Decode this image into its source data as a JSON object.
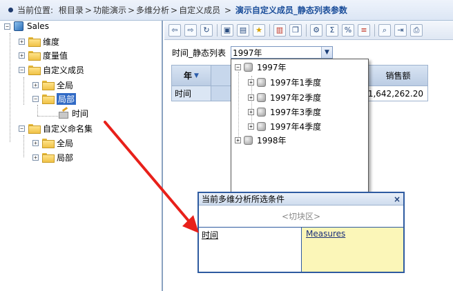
{
  "breadcrumb": {
    "prefix": "当前位置:",
    "parts": [
      "根目录",
      "功能演示",
      "多维分析",
      "自定义成员"
    ],
    "current": "演示自定义成员_静态列表参数"
  },
  "tree": {
    "root": "Sales",
    "items": [
      "维度",
      "度量值",
      "自定义成员",
      "全局",
      "局部",
      "时间",
      "自定义命名集",
      "全局",
      "局部"
    ]
  },
  "toolbar": {
    "icons": [
      "back-icon",
      "forward-icon",
      "refresh-icon",
      "save-icon",
      "save-as-icon",
      "favorite-icon",
      "chart-icon",
      "copy-icon",
      "settings-icon",
      "sum-icon",
      "format-icon",
      "filter-icon",
      "zoom-icon",
      "export-icon",
      "print-icon"
    ]
  },
  "param": {
    "label": "时间_静态列表",
    "value": "1997年"
  },
  "grid": {
    "row_header": "年",
    "measure_header": "销售额",
    "row_label": "时间",
    "value": "41,642,262.20"
  },
  "dropdown": {
    "items": [
      "1997年",
      "1997年1季度",
      "1997年2季度",
      "1997年3季度",
      "1997年4季度",
      "1998年"
    ]
  },
  "slicer": {
    "title": "当前多维分析所选条件",
    "close": "×",
    "zone": "<切块区>",
    "left": "时间",
    "right": "Measures"
  },
  "colors": {
    "arrow": "#e8201a",
    "selection": "#316ac5",
    "breadcrumb_current": "#1b4e9a"
  }
}
